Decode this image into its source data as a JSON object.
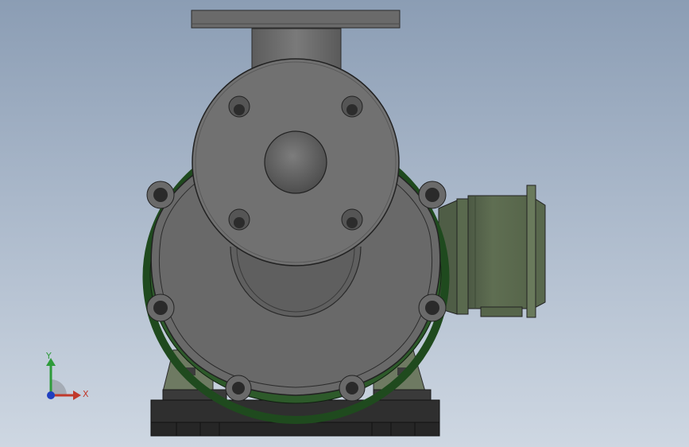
{
  "colors": {
    "background_top": "#8b9db4",
    "background_bottom": "#ced7e2",
    "body_gray": "#6b6b6b",
    "motor_green": "#5c6b50",
    "gasket_green": "#2d5a2a",
    "base_black": "#2a2a2a",
    "triad_x": "#c0392b",
    "triad_y": "#2e9b3a",
    "triad_z": "#2040c0"
  },
  "view_triad": {
    "x_label": "X",
    "y_label": "Y"
  }
}
